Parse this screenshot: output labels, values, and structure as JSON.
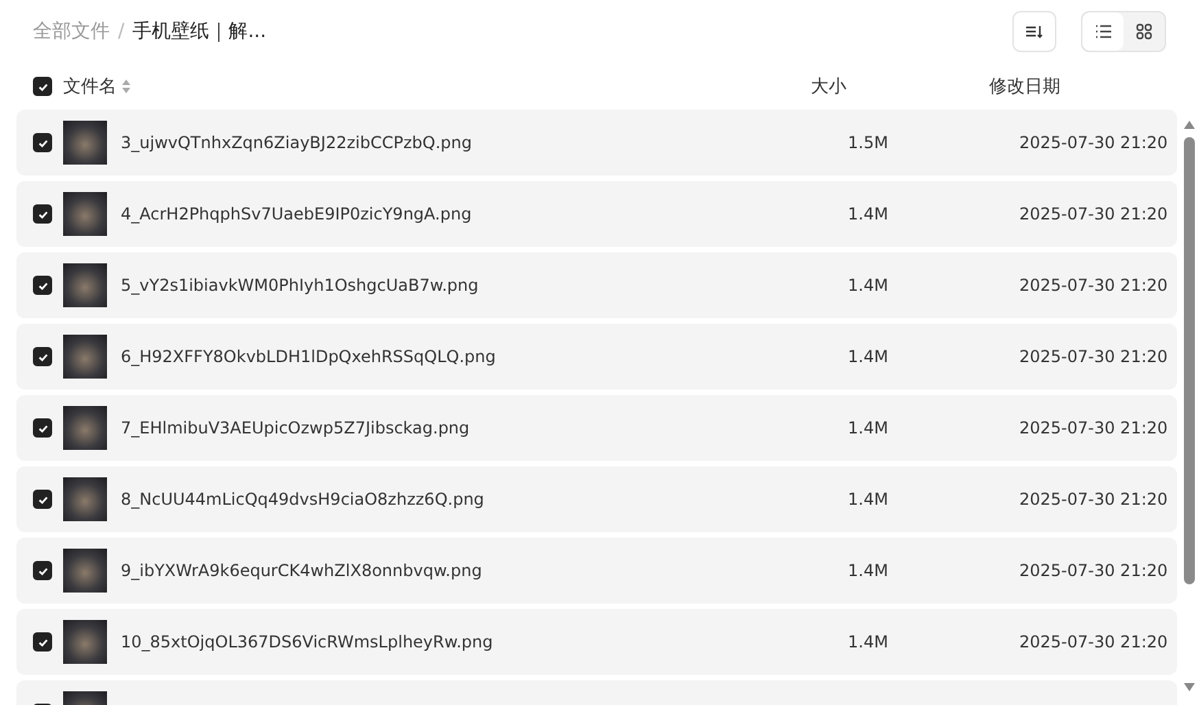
{
  "breadcrumb": [
    {
      "label": "全部文件",
      "current": false
    },
    {
      "label": "手机壁纸｜解...",
      "current": true
    }
  ],
  "breadcrumb_separator": "/",
  "view_toggle": [
    {
      "kind": "list",
      "selected": true
    },
    {
      "kind": "grid",
      "selected": false
    }
  ],
  "header": {
    "checked": true,
    "columns": [
      "文件名",
      "大小",
      "修改日期"
    ]
  },
  "rows": [
    {
      "checked": true,
      "name": "3_ujwvQTnhxZqn6ZiayBJ22zibCCPzbQ.png",
      "size": "1.5M",
      "modified": "2025-07-30 21:20"
    },
    {
      "checked": true,
      "name": "4_AcrH2PhqphSv7UaebE9IP0zicY9ngA.png",
      "size": "1.4M",
      "modified": "2025-07-30 21:20"
    },
    {
      "checked": true,
      "name": "5_vY2s1ibiavkWM0PhIyh1OshgcUaB7w.png",
      "size": "1.4M",
      "modified": "2025-07-30 21:20"
    },
    {
      "checked": true,
      "name": "6_H92XFFY8OkvbLDH1lDpQxehRSSqQLQ.png",
      "size": "1.4M",
      "modified": "2025-07-30 21:20"
    },
    {
      "checked": true,
      "name": "7_EHlmibuV3AEUpicOzwp5Z7Jibsckag.png",
      "size": "1.4M",
      "modified": "2025-07-30 21:20"
    },
    {
      "checked": true,
      "name": "8_NcUU44mLicQq49dvsH9ciaO8zhzz6Q.png",
      "size": "1.4M",
      "modified": "2025-07-30 21:20"
    },
    {
      "checked": true,
      "name": "9_ibYXWrA9k6equrCK4whZlX8onnbvqw.png",
      "size": "1.4M",
      "modified": "2025-07-30 21:20"
    },
    {
      "checked": true,
      "name": "10_85xtOjqOL367DS6VicRWmsLplheyRw.png",
      "size": "1.4M",
      "modified": "2025-07-30 21:20"
    },
    {
      "checked": true
    }
  ]
}
